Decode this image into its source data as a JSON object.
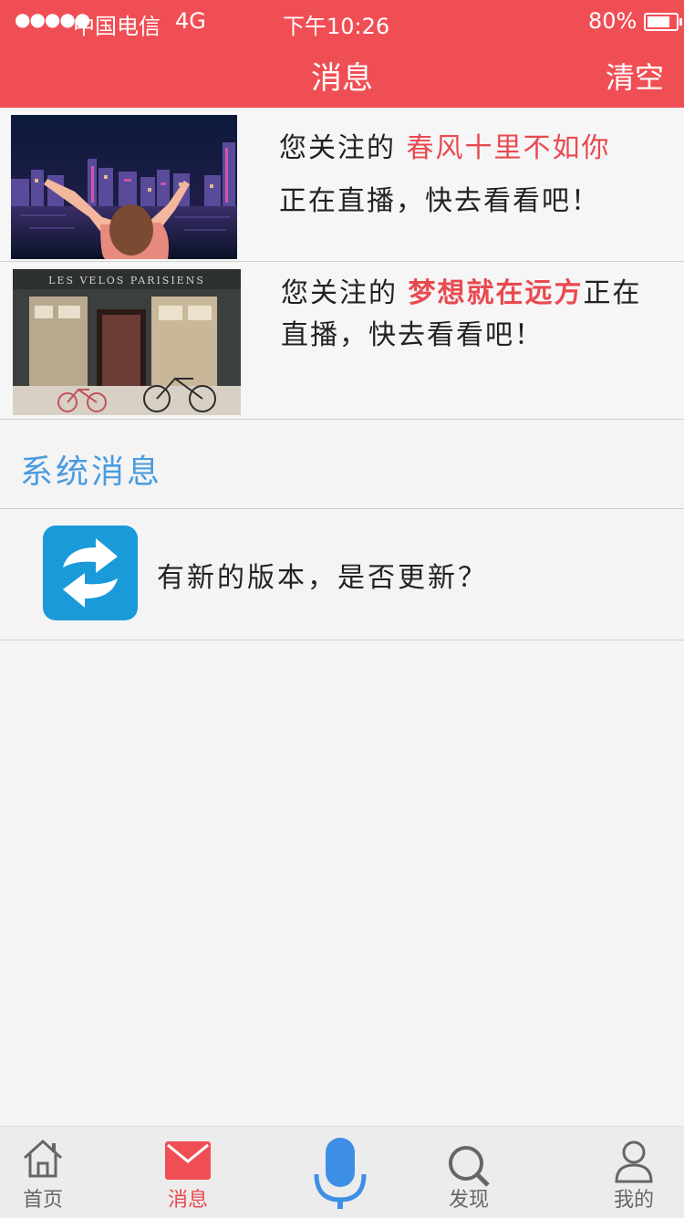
{
  "status_bar": {
    "signal": "●●●●●",
    "carrier": "中国电信",
    "network": "4G",
    "time": "下午10:26",
    "battery": "80%",
    "battery_level": 0.8
  },
  "header": {
    "title": "消息",
    "clear_label": "清空"
  },
  "live_notifications": [
    {
      "prefix": "您关注的 ",
      "streamer": "春风十里不如你",
      "suffix": "正在直播，快去看看吧！"
    },
    {
      "prefix": "您关注的 ",
      "streamer": "梦想就在远方",
      "suffix": "正在直播，快去看看吧！",
      "shop_sign": "LES VELOS PARISIENS"
    }
  ],
  "system": {
    "title": "系统消息",
    "update_text": "有新的版本，是否更新？"
  },
  "tabs": [
    {
      "label": "首页",
      "icon": "home-icon"
    },
    {
      "label": "消息",
      "icon": "mail-icon",
      "active": true
    },
    {
      "label": "",
      "icon": "microphone-icon"
    },
    {
      "label": "发现",
      "icon": "search-icon"
    },
    {
      "label": "我的",
      "icon": "user-icon"
    }
  ],
  "colors": {
    "accent": "#f04e55",
    "highlight": "#e84a50",
    "system_blue": "#4a9be0",
    "mic_blue": "#3d8fe6",
    "update_icon_bg": "#1a9ad9"
  }
}
